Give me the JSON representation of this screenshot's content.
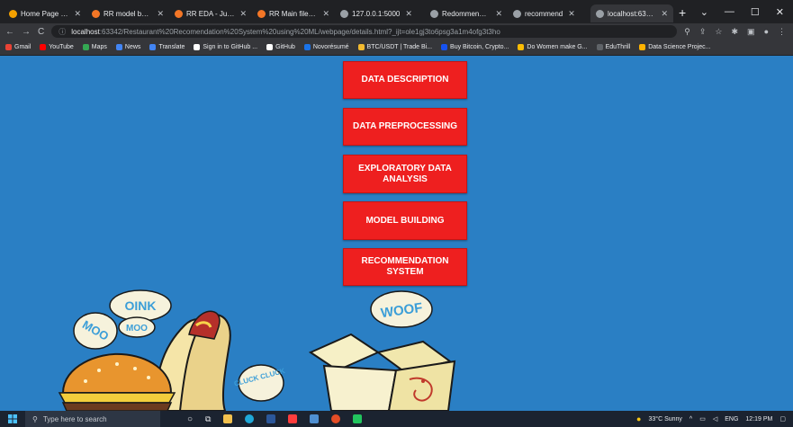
{
  "browser": {
    "tabs": [
      {
        "label": "Home Page - Sele",
        "color": "#f4a100"
      },
      {
        "label": "RR model buildin",
        "color": "#f37626"
      },
      {
        "label": "RR EDA - Jupyter",
        "color": "#f37626"
      },
      {
        "label": "RR Main file 1 - Ju",
        "color": "#f37626"
      },
      {
        "label": "127.0.0.1:5000",
        "color": "#9aa0a6"
      },
      {
        "label": "Redommendatio",
        "color": "#9aa0a6"
      },
      {
        "label": "recommend",
        "color": "#9aa0a6"
      },
      {
        "label": "localhost:63342/r",
        "color": "#9aa0a6",
        "active": true
      }
    ],
    "address_host": "localhost",
    "address_rest": ":63342/Restaurant%20Recomendation%20System%20using%20ML/webpage/details.html?_ijt=ole1gj3to6psg3a1m4ofg3t3ho",
    "bookmarks": [
      {
        "label": "Gmail",
        "color": "#ea4335"
      },
      {
        "label": "YouTube",
        "color": "#ff0000"
      },
      {
        "label": "Maps",
        "color": "#34a853"
      },
      {
        "label": "News",
        "color": "#4285f4"
      },
      {
        "label": "Translate",
        "color": "#4285f4"
      },
      {
        "label": "Sign in to GitHub ...",
        "color": "#ffffff"
      },
      {
        "label": "GitHub",
        "color": "#ffffff"
      },
      {
        "label": "Novorésumé",
        "color": "#1a73e8"
      },
      {
        "label": "BTC/USDT | Trade Bi...",
        "color": "#f3ba2f"
      },
      {
        "label": "Buy Bitcoin, Crypto...",
        "color": "#1652f0"
      },
      {
        "label": "Do Women make G...",
        "color": "#fbbc04"
      },
      {
        "label": "EduThrill",
        "color": "#5f6368"
      },
      {
        "label": "Data Science Projec...",
        "color": "#ffb300"
      }
    ]
  },
  "menu": {
    "data_description": "DATA DESCRIPTION",
    "data_preprocessing": "DATA PREPROCESSING",
    "eda": "EXPLORATORY DATA ANALYSIS",
    "model_building": "MODEL BUILDING",
    "recommendation": "RECOMMENDATION SYSTEM"
  },
  "illustration": {
    "bubble_oink": "OINK",
    "bubble_moo_small": "MOO",
    "bubble_moo": "MOO",
    "bubble_cluck": "CLUCK CLUCK",
    "bubble_woof": "WOOF"
  },
  "taskbar": {
    "search_placeholder": "Type here to search",
    "weather": "33°C Sunny",
    "lang": "ENG",
    "time": "12:19 PM"
  },
  "colors": {
    "page_bg": "#2a7fc4",
    "button_bg": "#ee1f1f",
    "button_text": "#ffffff"
  }
}
